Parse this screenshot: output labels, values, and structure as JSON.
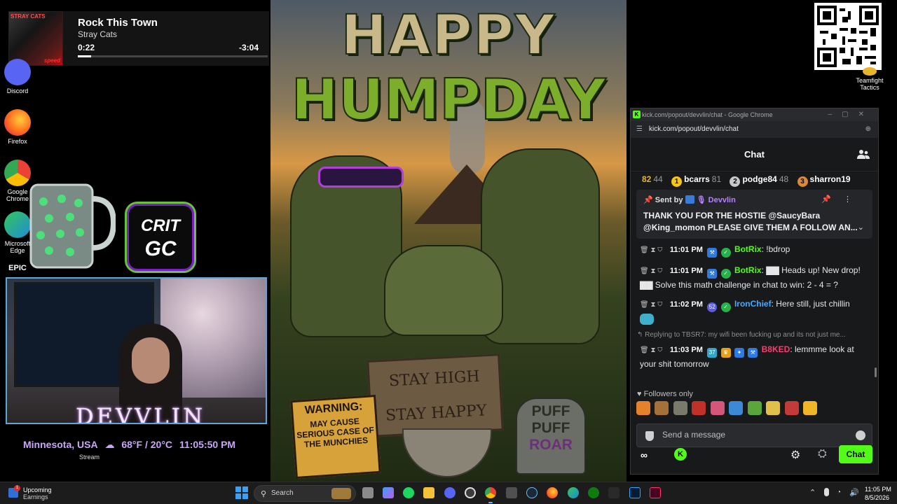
{
  "now_playing": {
    "title": "Rock This Town",
    "artist": "Stray Cats",
    "elapsed": "0:22",
    "remaining": "-3:04",
    "progress": 0.07,
    "art_badge": "STRAY CATS",
    "art_tag": "speed"
  },
  "desktop_icons": [
    {
      "label": "Discord",
      "icon": "discord-icon",
      "color": "#5865f2"
    },
    {
      "label": "Firefox",
      "icon": "firefox-icon",
      "color": "#ff6a1f"
    },
    {
      "label": "Google Chrome",
      "icon": "chrome-icon",
      "color": "#34a853"
    },
    {
      "label": "Microsoft Edge",
      "icon": "edge-icon",
      "color": "#1f8ad8"
    },
    {
      "label": "EPIC",
      "icon": "epic-games-icon",
      "color": "#2a2a2a"
    }
  ],
  "crit_logo": {
    "line1": "CRIT",
    "line2": "GC"
  },
  "overlay": {
    "streamer_name": "DEVVLIN",
    "location": "Minnesota, USA",
    "temperature": "68°F / 20°C",
    "time": "11:05:50 PM",
    "stream_label": "Stream"
  },
  "poster": {
    "line1": "HAPPY",
    "line2": "HUMPDAY",
    "sign_wood_1": "STAY HIGH",
    "sign_wood_2": "STAY HAPPY",
    "warning_head": "WARNING:",
    "warning_body": "MAY CAUSE SERIOUS CASE OF THE MUNCHIES",
    "stone_1": "PUFF",
    "stone_2": "PUFF",
    "stone_3": "ROAR"
  },
  "tft": {
    "label": "Teamfight Tactics"
  },
  "chat_window": {
    "window_title": "kick.com/popout/devvlin/chat - Google Chrome",
    "url": "kick.com/popout/devvlin/chat",
    "header": "Chat",
    "leaderboard": [
      {
        "rank": "",
        "name": "82",
        "score": "44",
        "color": "#e8b42a"
      },
      {
        "rank": "1",
        "name": "bcarrs",
        "score": "81",
        "color": "#f5c518"
      },
      {
        "rank": "2",
        "name": "podge84",
        "score": "48",
        "color": "#c7c7c7"
      },
      {
        "rank": "3",
        "name": "sharron19",
        "score": "",
        "color": "#d88a3a"
      }
    ],
    "pinned": {
      "sent_by_label": "Sent by",
      "sender": "Devvlin",
      "text_line1": "THANK YOU FOR THE HOSTIE @SaucyBara",
      "text_line2": "@King_momon PLEASE GIVE THEM A FOLLOW AN..."
    },
    "messages": [
      {
        "time": "11:01 PM",
        "user": "BotRix",
        "user_color": "#53fc18",
        "text": ": !bdrop"
      },
      {
        "time": "11:01 PM",
        "user": "BotRix",
        "user_color": "#53fc18",
        "text": ": ▇▇ Heads up! New drop! ▇▇ Solve this math challenge in chat to win: 2 - 4 = ?"
      },
      {
        "time": "11:02 PM",
        "user": "IronChief",
        "user_color": "#4aa8ff",
        "text": ": Here still, just chillin"
      },
      {
        "reply": "Replying to TBSR7: my wifi been fucking up and its not just me...",
        "time": "11:03 PM",
        "user": "B8KED",
        "user_color": "#ff3b6b",
        "text": ": lemmme look at your shit tomorrow"
      }
    ],
    "followers_only": "Followers only",
    "input_placeholder": "Send a message",
    "send_label": "Chat",
    "footer_infinity": "∞",
    "footer_kick": "K"
  },
  "taskbar": {
    "earnings_title": "Upcoming",
    "earnings_sub": "Earnings",
    "earnings_badge": "1",
    "search_label": "Search",
    "clock_time": "11:05 PM",
    "clock_date": "8/5/2026"
  },
  "colors": {
    "kick_green": "#53fc18",
    "chat_bg": "#18191b",
    "taskbar_bg": "#1c1c1c",
    "overlay_purple": "#c9a6f7"
  }
}
